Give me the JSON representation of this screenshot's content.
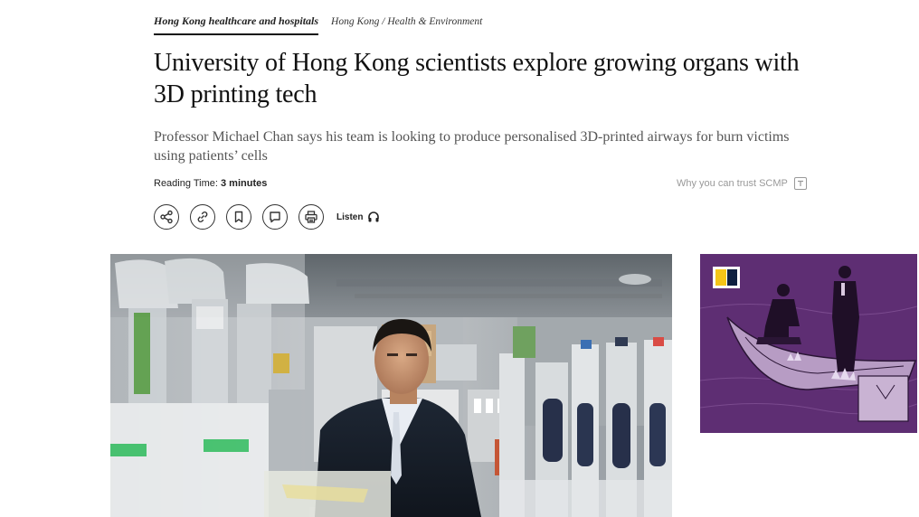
{
  "article": {
    "tags": {
      "primary": "Hong Kong healthcare and hospitals",
      "secondary": "Hong Kong / Health & Environment"
    },
    "headline": "University of Hong Kong scientists explore growing organs with 3D printing tech",
    "subheadline": "Professor Michael Chan says his team is looking to produce personalised 3D-printed airways for burn victims using patients’ cells",
    "reading_time": {
      "label": "Reading Time:",
      "value": "3 minutes"
    },
    "trust_link": "Why you can trust SCMP",
    "actions": {
      "icons": [
        "share-icon",
        "link-icon",
        "bookmark-icon",
        "comment-icon",
        "print-icon",
        "headphones-icon"
      ],
      "listen_label": "Listen"
    }
  },
  "colors": {
    "ad_background": "#5e2e73",
    "ad_logo_yellow": "#f5c518",
    "ad_logo_navy": "#0e1f3f"
  }
}
